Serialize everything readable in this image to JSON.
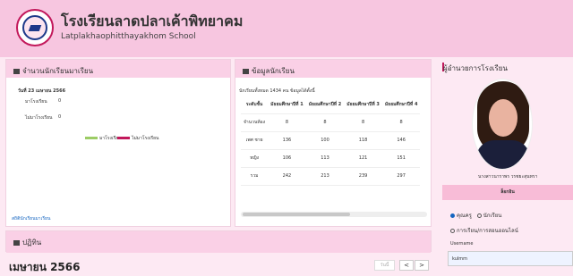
{
  "school": {
    "name_th": "โรงเรียนลาดปลาเค้าพิทยาคม",
    "name_en": "Latplakhaophitthayakhom School"
  },
  "panel_students": {
    "title": "จำนวนนักเรียนมาเรียน",
    "date": "วันที่ 23 เมษายน 2566",
    "present_label": "มาโรงเรียน",
    "present_value": "0",
    "absent_label": "ไม่มาโรงเรียน",
    "absent_value": "0",
    "legend_present": "มาโรงเรียน",
    "legend_absent": "ไม่มาโรงเรียน",
    "link": "สถิตินักเรียนมาเรียน"
  },
  "panel_info": {
    "title": "ข้อมูลนักเรียน",
    "summary": "นักเรียนทั้งหมด 1434 คน ข้อมูลได้ตั้งนี้",
    "headers": [
      "ระดับชั้น",
      "มัธยมศึกษาปีที่ 1",
      "มัธยมศึกษาปีที่ 2",
      "มัธยมศึกษาปีที่ 3",
      "มัธยมศึกษาปีที่ 4"
    ],
    "rows": [
      [
        "จำนวนห้อง",
        "8",
        "8",
        "8",
        "8"
      ],
      [
        "เพศ ชาย",
        "136",
        "100",
        "118",
        "146"
      ],
      [
        "หญิง",
        "106",
        "113",
        "121",
        "151"
      ],
      [
        "รวม",
        "242",
        "213",
        "239",
        "297"
      ]
    ]
  },
  "calendar": {
    "section": "ปฏิทิน",
    "month": "เมษายน 2566",
    "today": "วันนี้",
    "prev": "<",
    "next": ">"
  },
  "director": {
    "title": "ผู้อำนวยการโรงเรียน",
    "name": "นางสาวนาราพร วรชยะสุนทรา"
  },
  "login": {
    "title": "ล็อกอิน",
    "option1": "คุณครู",
    "option2": "นักเรียน",
    "option3": "การเรียน/การสอนออนไลน์",
    "username_label": "Username",
    "username_value": "kulmm"
  }
}
